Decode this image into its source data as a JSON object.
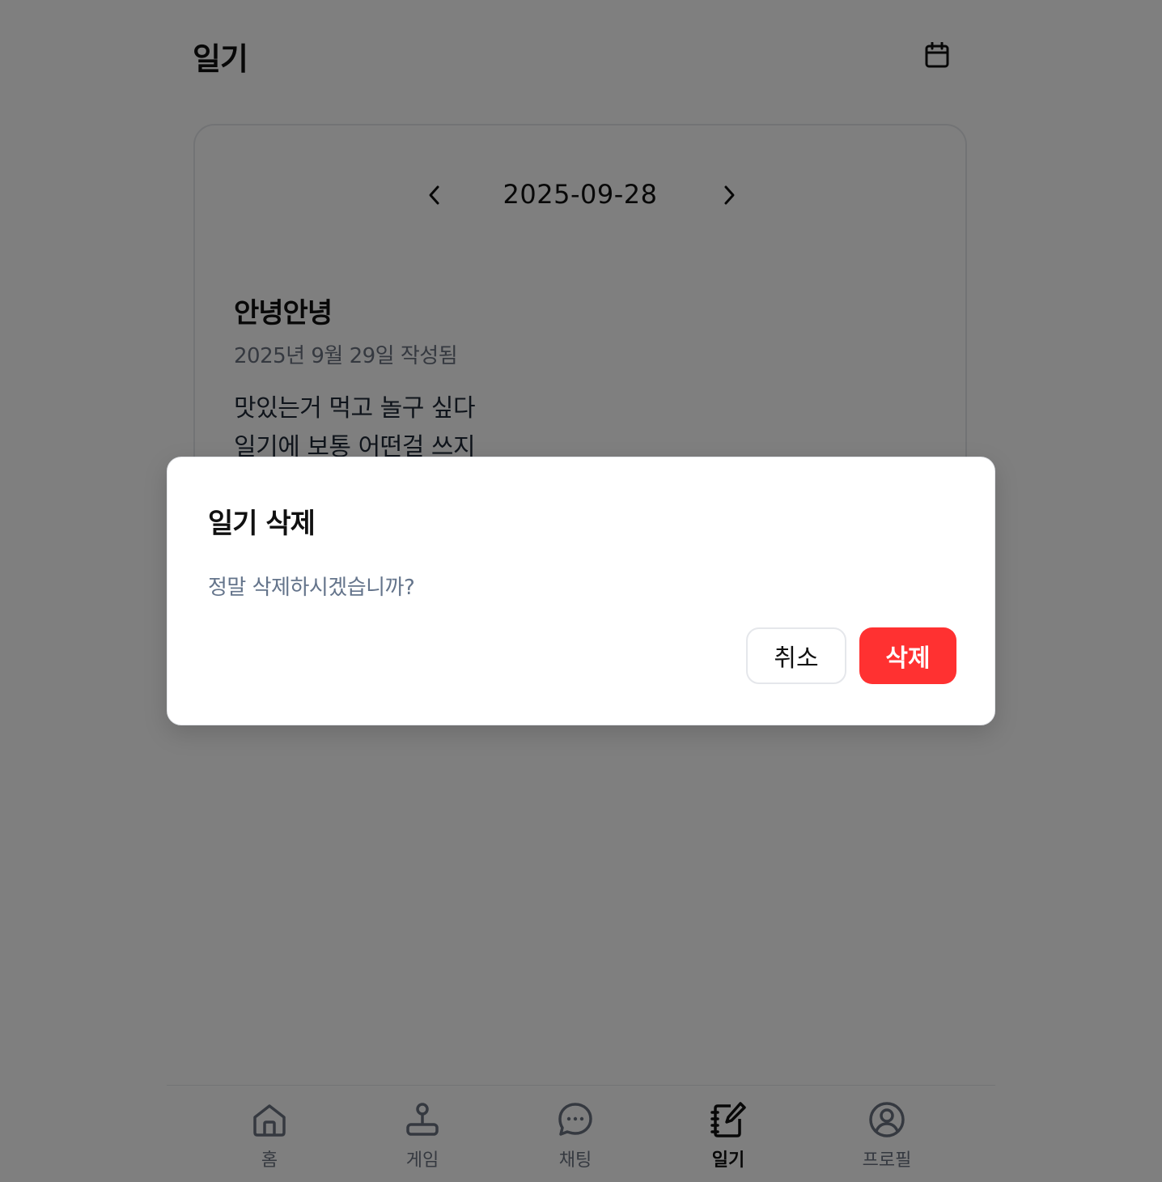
{
  "header": {
    "title": "일기",
    "calendar_icon": "calendar-icon"
  },
  "date_nav": {
    "date": "2025-09-28",
    "prev_icon": "chevron-left-icon",
    "next_icon": "chevron-right-icon"
  },
  "entry": {
    "title": "안녕안녕",
    "meta": "2025년 9월 29일 작성됨",
    "lines": [
      "맛있는거 먹고 놀구 싶다",
      "일기에 보통 어떤걸 쓰지"
    ]
  },
  "bottom_nav": {
    "tabs": [
      {
        "label": "홈",
        "icon": "home-icon",
        "active": false
      },
      {
        "label": "게임",
        "icon": "joystick-icon",
        "active": false
      },
      {
        "label": "채팅",
        "icon": "chat-bubble-icon",
        "active": false
      },
      {
        "label": "일기",
        "icon": "notebook-pen-icon",
        "active": true
      },
      {
        "label": "프로필",
        "icon": "user-circle-icon",
        "active": false
      }
    ]
  },
  "modal": {
    "title": "일기 삭제",
    "message": "정말 삭제하시겠습니까?",
    "cancel_label": "취소",
    "delete_label": "삭제"
  },
  "colors": {
    "overlay": "#000000",
    "danger": "#ff3131",
    "text_primary": "#111111",
    "text_muted": "#6b7280"
  }
}
